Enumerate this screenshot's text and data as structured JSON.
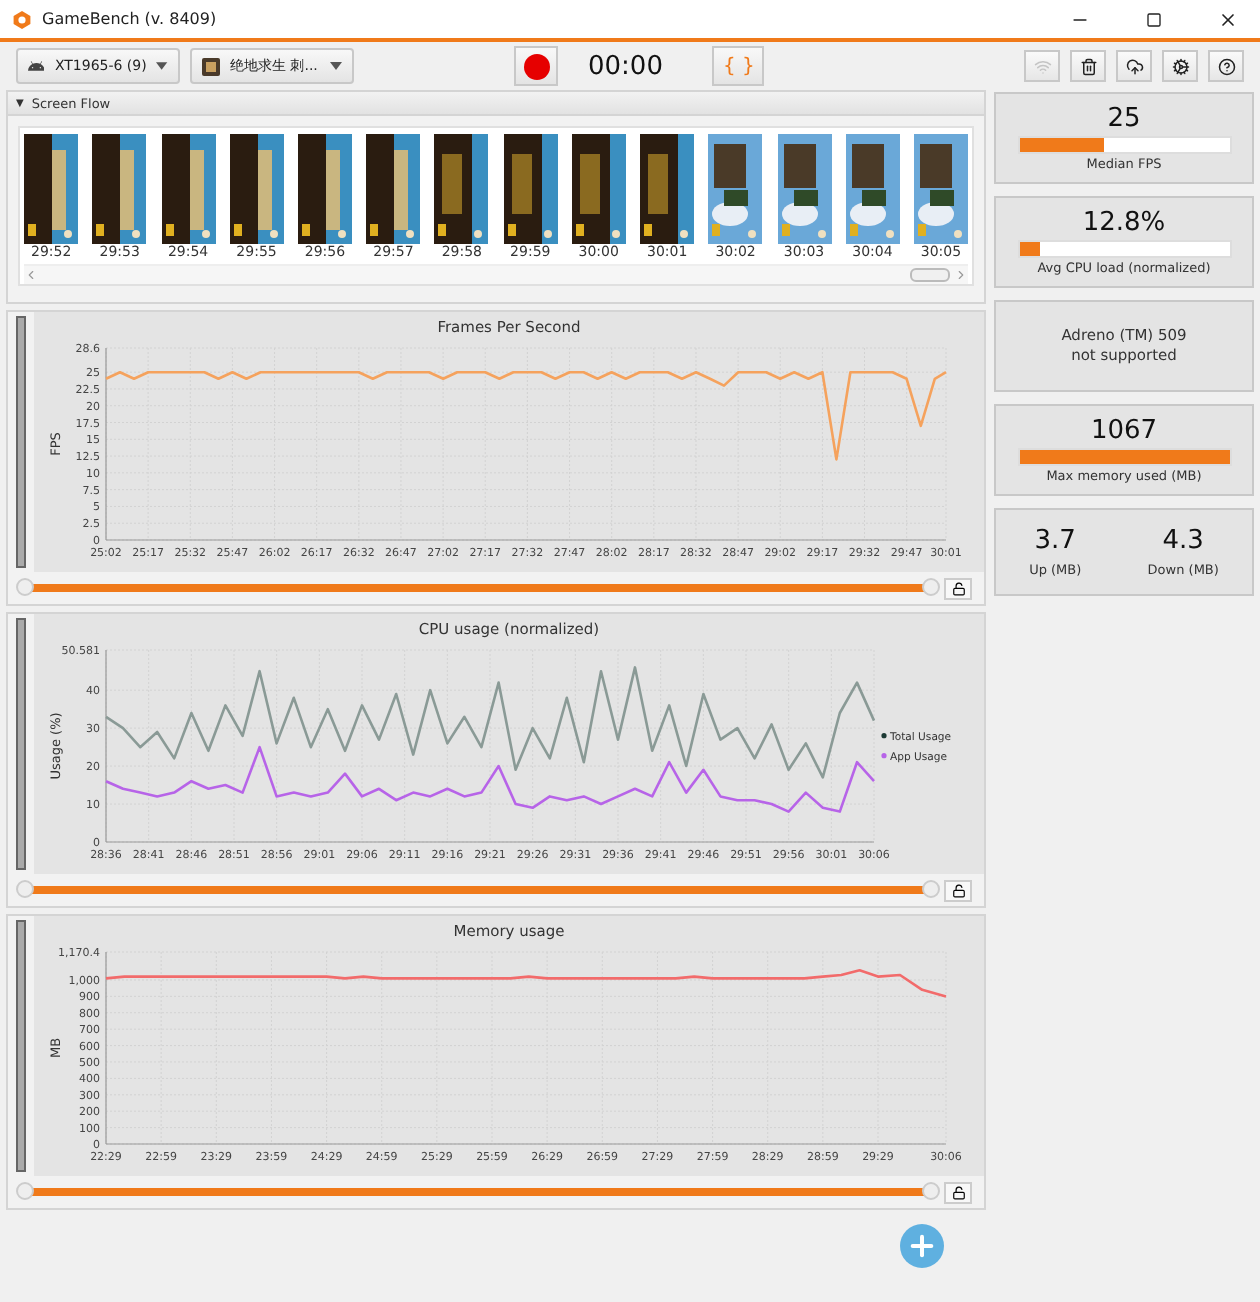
{
  "window": {
    "title": "GameBench (v. 8409)"
  },
  "toolbar": {
    "device": "XT1965-6 (9)",
    "app": "绝地求生 刺...",
    "timer": "00:00",
    "script_button": "{ }",
    "actions": [
      {
        "kind": "wifi",
        "disabled": true
      },
      {
        "kind": "delete",
        "disabled": false
      },
      {
        "kind": "upload",
        "disabled": false
      },
      {
        "kind": "settings",
        "disabled": false
      },
      {
        "kind": "help",
        "disabled": false
      }
    ]
  },
  "screen_flow": {
    "toggle": "▼",
    "title": "Screen Flow",
    "expanded": true,
    "frames": [
      {
        "time": "29:52"
      },
      {
        "time": "29:53"
      },
      {
        "time": "29:54"
      },
      {
        "time": "29:55"
      },
      {
        "time": "29:56"
      },
      {
        "time": "29:57"
      },
      {
        "time": "29:58"
      },
      {
        "time": "29:59"
      },
      {
        "time": "30:00"
      },
      {
        "time": "30:01"
      },
      {
        "time": "30:02"
      },
      {
        "time": "30:03"
      },
      {
        "time": "30:04"
      },
      {
        "time": "30:05"
      }
    ]
  },
  "charts": [
    {
      "title": "Frames Per Second",
      "slider": {
        "level": 1
      },
      "chart_data": {
        "type": "line",
        "grid": true,
        "ylabel": "FPS",
        "xlim": [
          1502,
          1801
        ],
        "x": [
          1502,
          1507,
          1512,
          1517,
          1522,
          1527,
          1532,
          1537,
          1542,
          1547,
          1552,
          1557,
          1562,
          1567,
          1572,
          1577,
          1582,
          1587,
          1592,
          1597,
          1602,
          1607,
          1612,
          1617,
          1622,
          1627,
          1632,
          1637,
          1642,
          1647,
          1652,
          1657,
          1662,
          1667,
          1672,
          1677,
          1682,
          1687,
          1692,
          1697,
          1702,
          1707,
          1712,
          1717,
          1722,
          1727,
          1732,
          1737,
          1742,
          1747,
          1752,
          1757,
          1762,
          1767,
          1772,
          1777,
          1782,
          1787,
          1792,
          1797,
          1801
        ],
        "ylim": [
          0,
          28.6
        ],
        "yticks": [
          0,
          2.5,
          5,
          7.5,
          10,
          12.5,
          15,
          17.5,
          20,
          22.5,
          25,
          28.6
        ],
        "xticks": [
          {
            "value": 1502,
            "label": "25:02"
          },
          {
            "value": 1517,
            "label": "25:17"
          },
          {
            "value": 1532,
            "label": "25:32"
          },
          {
            "value": 1547,
            "label": "25:47"
          },
          {
            "value": 1562,
            "label": "26:02"
          },
          {
            "value": 1577,
            "label": "26:17"
          },
          {
            "value": 1592,
            "label": "26:32"
          },
          {
            "value": 1607,
            "label": "26:47"
          },
          {
            "value": 1622,
            "label": "27:02"
          },
          {
            "value": 1637,
            "label": "27:17"
          },
          {
            "value": 1652,
            "label": "27:32"
          },
          {
            "value": 1667,
            "label": "27:47"
          },
          {
            "value": 1682,
            "label": "28:02"
          },
          {
            "value": 1697,
            "label": "28:17"
          },
          {
            "value": 1712,
            "label": "28:32"
          },
          {
            "value": 1727,
            "label": "28:47"
          },
          {
            "value": 1742,
            "label": "29:02"
          },
          {
            "value": 1757,
            "label": "29:17"
          },
          {
            "value": 1772,
            "label": "29:32"
          },
          {
            "value": 1787,
            "label": "29:47"
          },
          {
            "value": 1801,
            "label": "30:01"
          }
        ],
        "series": [
          {
            "color": "#f5a25d",
            "values": [
              24,
              25,
              24,
              25,
              25,
              25,
              25,
              25,
              24,
              25,
              24,
              25,
              25,
              25,
              25,
              25,
              25,
              25,
              25,
              24,
              25,
              25,
              25,
              25,
              24,
              25,
              25,
              25,
              24,
              25,
              25,
              25,
              24,
              25,
              25,
              24,
              25,
              24,
              25,
              25,
              25,
              24,
              25,
              24,
              23,
              25,
              25,
              25,
              24,
              25,
              24,
              25,
              12,
              25,
              25,
              25,
              25,
              24,
              17,
              24,
              25
            ]
          }
        ]
      }
    },
    {
      "title": "CPU usage (normalized)",
      "slider": {
        "level": 1
      },
      "chart_data": {
        "type": "line",
        "grid": true,
        "ylabel": "Usage (%)",
        "xlim": [
          1716,
          1806
        ],
        "x": [
          1716,
          1718,
          1720,
          1722,
          1724,
          1726,
          1728,
          1730,
          1732,
          1734,
          1736,
          1738,
          1740,
          1742,
          1744,
          1746,
          1748,
          1750,
          1752,
          1754,
          1756,
          1758,
          1760,
          1762,
          1764,
          1766,
          1768,
          1770,
          1772,
          1774,
          1776,
          1778,
          1780,
          1782,
          1784,
          1786,
          1788,
          1790,
          1792,
          1794,
          1796,
          1798,
          1800,
          1802,
          1804,
          1806
        ],
        "ylim": [
          0,
          50.581
        ],
        "yticks": [
          0,
          10,
          20,
          30,
          40,
          50.581
        ],
        "xticks": [
          {
            "value": 1716,
            "label": "28:36"
          },
          {
            "value": 1721,
            "label": "28:41"
          },
          {
            "value": 1726,
            "label": "28:46"
          },
          {
            "value": 1731,
            "label": "28:51"
          },
          {
            "value": 1736,
            "label": "28:56"
          },
          {
            "value": 1741,
            "label": "29:01"
          },
          {
            "value": 1746,
            "label": "29:06"
          },
          {
            "value": 1751,
            "label": "29:11"
          },
          {
            "value": 1756,
            "label": "29:16"
          },
          {
            "value": 1761,
            "label": "29:21"
          },
          {
            "value": 1766,
            "label": "29:26"
          },
          {
            "value": 1771,
            "label": "29:31"
          },
          {
            "value": 1776,
            "label": "29:36"
          },
          {
            "value": 1781,
            "label": "29:41"
          },
          {
            "value": 1786,
            "label": "29:46"
          },
          {
            "value": 1791,
            "label": "29:51"
          },
          {
            "value": 1796,
            "label": "29:56"
          },
          {
            "value": 1801,
            "label": "30:01"
          },
          {
            "value": 1806,
            "label": "30:06"
          }
        ],
        "series": [
          {
            "name": "Total Usage",
            "color": "#8a9a96",
            "values": [
              33,
              30,
              25,
              29,
              22,
              34,
              24,
              36,
              28,
              45,
              26,
              38,
              25,
              35,
              24,
              36,
              27,
              39,
              23,
              40,
              26,
              33,
              25,
              42,
              19,
              30,
              22,
              38,
              21,
              45,
              27,
              46,
              24,
              36,
              20,
              39,
              27,
              30,
              22,
              31,
              19,
              26,
              17,
              34,
              42,
              32
            ]
          },
          {
            "name": "App Usage",
            "color": "#b764e8",
            "values": [
              16,
              14,
              13,
              12,
              13,
              16,
              14,
              15,
              13,
              25,
              12,
              13,
              12,
              13,
              18,
              12,
              14,
              11,
              13,
              12,
              14,
              12,
              13,
              20,
              10,
              9,
              12,
              11,
              12,
              10,
              12,
              14,
              12,
              21,
              13,
              19,
              12,
              11,
              11,
              10,
              8,
              13,
              9,
              8,
              21,
              16
            ]
          }
        ]
      }
    },
    {
      "title": "Memory usage",
      "slider": {
        "level": 1
      },
      "chart_data": {
        "type": "line",
        "grid": true,
        "ylabel": "MB",
        "xlim": [
          1349,
          1806
        ],
        "x": [
          1349,
          1359,
          1369,
          1379,
          1389,
          1399,
          1409,
          1419,
          1429,
          1439,
          1449,
          1459,
          1469,
          1479,
          1489,
          1499,
          1509,
          1519,
          1529,
          1539,
          1549,
          1559,
          1569,
          1579,
          1589,
          1599,
          1609,
          1619,
          1629,
          1639,
          1649,
          1659,
          1669,
          1679,
          1689,
          1699,
          1709,
          1719,
          1729,
          1739,
          1749,
          1759,
          1769,
          1781,
          1793,
          1806
        ],
        "ylim": [
          0,
          1170.4
        ],
        "yticks": [
          0,
          100,
          200,
          300,
          400,
          500,
          600,
          700,
          800,
          900,
          {
            "value": 1000,
            "label": "1,000"
          },
          {
            "value": 1170.4,
            "label": "1,170.4"
          }
        ],
        "xticks": [
          {
            "value": 1349,
            "label": "22:29"
          },
          {
            "value": 1379,
            "label": "22:59"
          },
          {
            "value": 1409,
            "label": "23:29"
          },
          {
            "value": 1439,
            "label": "23:59"
          },
          {
            "value": 1469,
            "label": "24:29"
          },
          {
            "value": 1499,
            "label": "24:59"
          },
          {
            "value": 1529,
            "label": "25:29"
          },
          {
            "value": 1559,
            "label": "25:59"
          },
          {
            "value": 1589,
            "label": "26:29"
          },
          {
            "value": 1619,
            "label": "26:59"
          },
          {
            "value": 1649,
            "label": "27:29"
          },
          {
            "value": 1679,
            "label": "27:59"
          },
          {
            "value": 1709,
            "label": "28:29"
          },
          {
            "value": 1739,
            "label": "28:59"
          },
          {
            "value": 1769,
            "label": "29:29"
          },
          {
            "value": 1806,
            "label": "30:06"
          }
        ],
        "series": [
          {
            "color": "#f26b6b",
            "values": [
              1010,
              1020,
              1020,
              1020,
              1020,
              1020,
              1020,
              1020,
              1020,
              1020,
              1020,
              1020,
              1020,
              1010,
              1020,
              1010,
              1010,
              1010,
              1010,
              1010,
              1010,
              1010,
              1010,
              1020,
              1010,
              1010,
              1010,
              1010,
              1010,
              1010,
              1010,
              1010,
              1020,
              1010,
              1010,
              1010,
              1010,
              1010,
              1010,
              1020,
              1030,
              1060,
              1020,
              1030,
              940,
              900
            ]
          }
        ]
      }
    }
  ],
  "stats": [
    {
      "kind": "meter",
      "value": "25",
      "level": 0.4,
      "label": "Median FPS"
    },
    {
      "kind": "meter",
      "value": "12.8%",
      "level": 0.1,
      "label": "Avg CPU load (normalized)"
    },
    {
      "kind": "message",
      "lines": [
        "Adreno (TM) 509",
        "not supported"
      ]
    },
    {
      "kind": "meter",
      "value": "1067",
      "level": 1.0,
      "label": "Max memory used (MB)"
    },
    {
      "kind": "pair",
      "items": [
        {
          "value": "3.7",
          "label": "Up (MB)"
        },
        {
          "value": "4.3",
          "label": "Down (MB)"
        }
      ]
    }
  ]
}
